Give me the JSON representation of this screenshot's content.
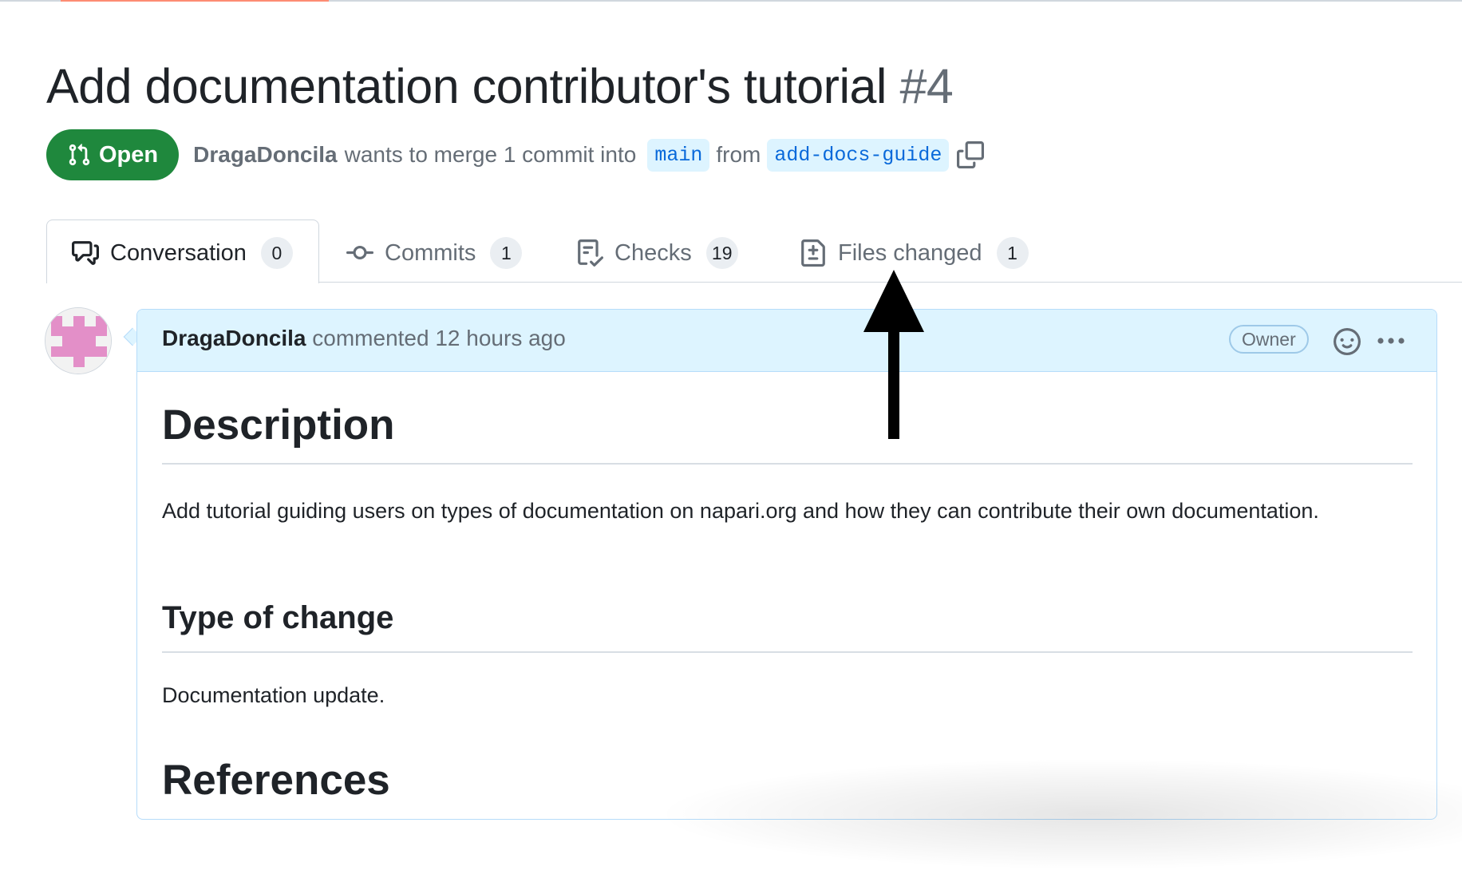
{
  "pull_request": {
    "title": "Add documentation contributor's tutorial",
    "number": "#4",
    "state": "Open",
    "author": "DragaDoncila",
    "merge_text_1": "wants to merge 1 commit into",
    "base_branch": "main",
    "merge_text_2": "from",
    "head_branch": "add-docs-guide"
  },
  "tabs": [
    {
      "label": "Conversation",
      "count": "0",
      "icon": "comment-discussion-icon",
      "active": true
    },
    {
      "label": "Commits",
      "count": "1",
      "icon": "git-commit-icon",
      "active": false
    },
    {
      "label": "Checks",
      "count": "19",
      "icon": "checklist-icon",
      "active": false
    },
    {
      "label": "Files changed",
      "count": "1",
      "icon": "file-diff-icon",
      "active": false
    }
  ],
  "comment": {
    "author": "DragaDoncila",
    "action": "commented 12 hours ago",
    "role_badge": "Owner",
    "body": {
      "h1_description": "Description",
      "description_text": "Add tutorial guiding users on types of documentation on napari.org and how they can contribute their own documentation.",
      "h2_type": "Type of change",
      "type_text": "Documentation update.",
      "h1_references": "References"
    }
  },
  "colors": {
    "open_green": "#1f883d",
    "branch_blue": "#0969da",
    "branch_bg": "#ddf4ff",
    "comment_header_bg": "#ddf4ff",
    "tab_accent": "#fd8c73",
    "avatar_pink": "#e38fc8"
  }
}
